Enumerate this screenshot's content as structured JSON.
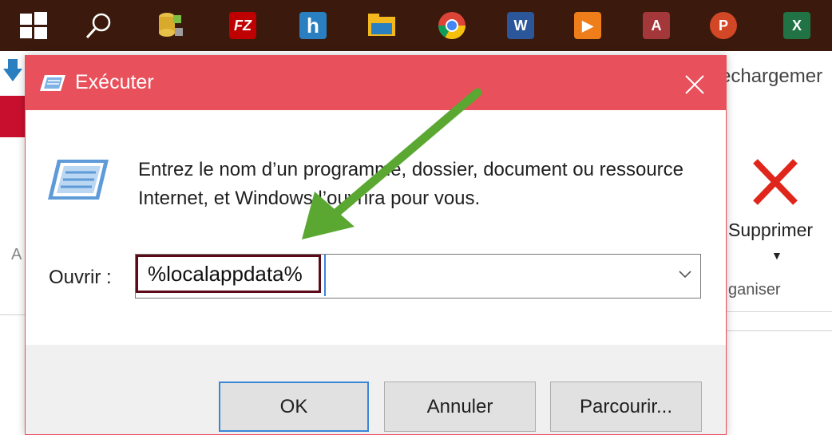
{
  "taskbar": {
    "icons": [
      {
        "name": "windows-start-icon",
        "glyph": "",
        "color": "#ffffff"
      },
      {
        "name": "search-icon",
        "glyph": "",
        "color": "#ffffff"
      },
      {
        "name": "database-tool-icon",
        "glyph": "",
        "color": "#e7c14a"
      },
      {
        "name": "filezilla-icon",
        "glyph": "FZ",
        "color": "#bf0000"
      },
      {
        "name": "h-app-icon",
        "glyph": "h",
        "color": "#2a7fc1"
      },
      {
        "name": "file-explorer-icon",
        "glyph": "",
        "color": "#f2b81d"
      },
      {
        "name": "chrome-icon",
        "glyph": "",
        "color": "#4caf50"
      },
      {
        "name": "word-icon",
        "glyph": "W",
        "color": "#2b579a"
      },
      {
        "name": "media-player-icon",
        "glyph": "▶",
        "color": "#ef7d1a"
      },
      {
        "name": "access-icon",
        "glyph": "A",
        "color": "#a4373a"
      },
      {
        "name": "powerpoint-icon",
        "glyph": "P",
        "color": "#d24726"
      },
      {
        "name": "excel-icon",
        "glyph": "X",
        "color": "#217346"
      }
    ]
  },
  "background_window": {
    "title_fragment": "echargemer",
    "delete_label": "Supprimer",
    "group_label_fragment": "ganiser",
    "left_fragment": "A",
    "accent_color": "#c8102e"
  },
  "dialog": {
    "title": "Exécuter",
    "description": "Entrez le nom d’un programme, dossier, document ou ressource Internet, et Windows l’ouvrira pour vous.",
    "open_label": "Ouvrir :",
    "open_value": "%localappdata%",
    "buttons": {
      "ok": "OK",
      "cancel": "Annuler",
      "browse": "Parcourir..."
    },
    "titlebar_color": "#e8505b",
    "highlight_color": "#5c0a17",
    "annotation_color": "#5aa832"
  }
}
